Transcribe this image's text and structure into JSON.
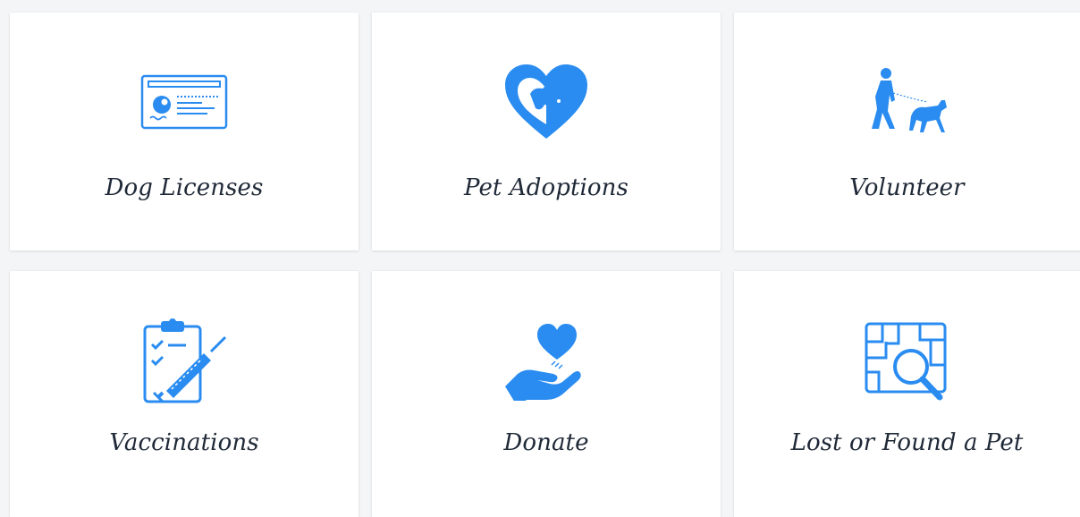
{
  "cards": [
    {
      "label": "Dog Licenses",
      "icon": "license-card-icon"
    },
    {
      "label": "Pet Adoptions",
      "icon": "heart-dog-cat-icon"
    },
    {
      "label": "Volunteer",
      "icon": "person-walking-dog-icon"
    },
    {
      "label": "Vaccinations",
      "icon": "clipboard-syringe-icon"
    },
    {
      "label": "Donate",
      "icon": "hand-heart-icon"
    },
    {
      "label": "Lost or Found a Pet",
      "icon": "map-search-icon"
    }
  ],
  "colors": {
    "accent": "#2a8cf0",
    "text": "#1f2937",
    "card": "#ffffff",
    "background": "#f4f5f6"
  }
}
